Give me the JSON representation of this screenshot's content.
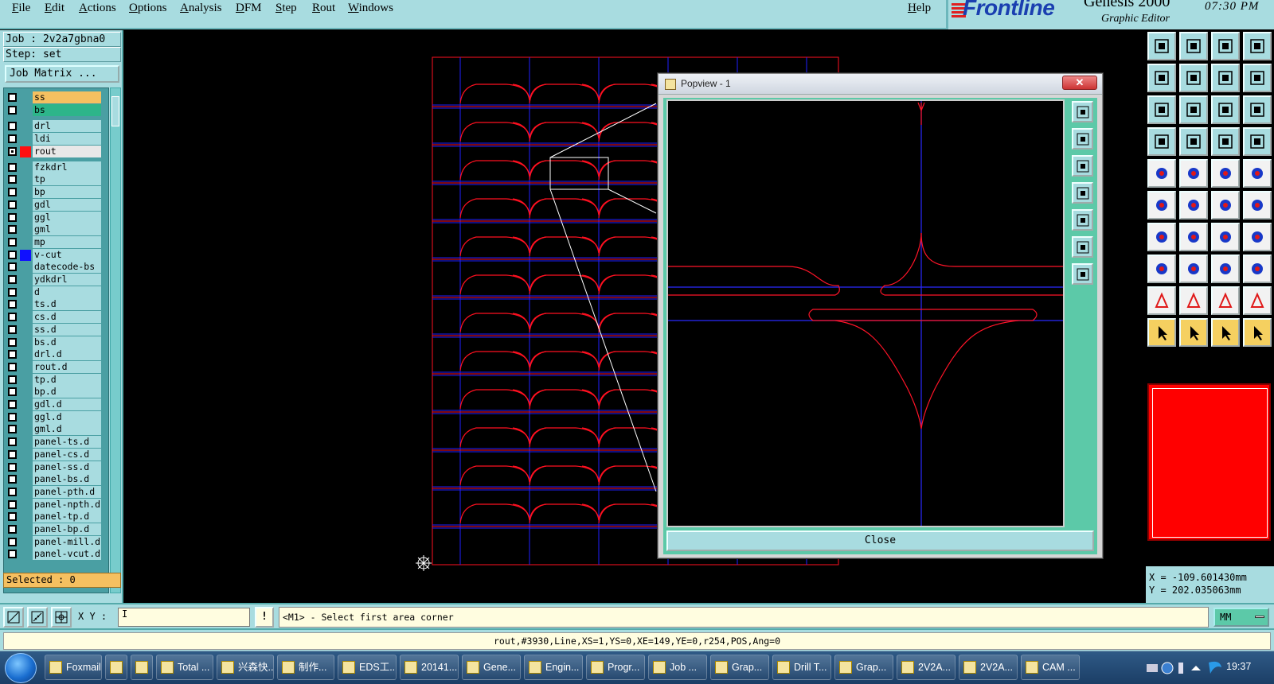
{
  "menu": [
    "File",
    "Edit",
    "Actions",
    "Options",
    "Analysis",
    "DFM",
    "Step",
    "Rout",
    "Windows"
  ],
  "help_label": "Help",
  "brand": {
    "logo": "Frontline",
    "product": "Genesis 2000",
    "subtitle": "Graphic Editor",
    "time": "07:30 PM"
  },
  "job_info": {
    "job": "Job : 2v2a7gbna0",
    "step": "Step: set"
  },
  "job_matrix_label": "Job Matrix ...",
  "layers": [
    {
      "name": "ss",
      "color": "#f5c060"
    },
    {
      "name": "bs",
      "color": "#2db58a"
    },
    {
      "name": "drl",
      "color": "#a8dce0"
    },
    {
      "name": "ldi",
      "color": "#a8dce0"
    },
    {
      "name": "rout",
      "color": "#e8e8e8",
      "swatch": "#ff1010",
      "active": true
    },
    {
      "name": "fzkdrl",
      "color": "#a8dce0"
    },
    {
      "name": "tp",
      "color": "#a8dce0"
    },
    {
      "name": "bp",
      "color": "#a8dce0"
    },
    {
      "name": "gdl",
      "color": "#a8dce0"
    },
    {
      "name": "ggl",
      "color": "#a8dce0"
    },
    {
      "name": "gml",
      "color": "#a8dce0"
    },
    {
      "name": "mp",
      "color": "#a8dce0"
    },
    {
      "name": "v-cut",
      "color": "#a8dce0",
      "swatch": "#1010ff"
    },
    {
      "name": "datecode-bs",
      "color": "#a8dce0"
    },
    {
      "name": "ydkdrl",
      "color": "#a8dce0"
    },
    {
      "name": "d",
      "color": "#a8dce0"
    },
    {
      "name": "ts.d",
      "color": "#a8dce0"
    },
    {
      "name": "cs.d",
      "color": "#a8dce0"
    },
    {
      "name": "ss.d",
      "color": "#a8dce0"
    },
    {
      "name": "bs.d",
      "color": "#a8dce0"
    },
    {
      "name": "drl.d",
      "color": "#a8dce0"
    },
    {
      "name": "rout.d",
      "color": "#a8dce0"
    },
    {
      "name": "tp.d",
      "color": "#a8dce0"
    },
    {
      "name": "bp.d",
      "color": "#a8dce0"
    },
    {
      "name": "gdl.d",
      "color": "#a8dce0"
    },
    {
      "name": "ggl.d",
      "color": "#a8dce0"
    },
    {
      "name": "gml.d",
      "color": "#a8dce0"
    },
    {
      "name": "panel-ts.d",
      "color": "#a8dce0"
    },
    {
      "name": "panel-cs.d",
      "color": "#a8dce0"
    },
    {
      "name": "panel-ss.d",
      "color": "#a8dce0"
    },
    {
      "name": "panel-bs.d",
      "color": "#a8dce0"
    },
    {
      "name": "panel-pth.d",
      "color": "#a8dce0"
    },
    {
      "name": "panel-npth.d",
      "color": "#a8dce0"
    },
    {
      "name": "panel-tp.d",
      "color": "#a8dce0"
    },
    {
      "name": "panel-bp.d",
      "color": "#a8dce0"
    },
    {
      "name": "panel-mill.d",
      "color": "#a8dce0"
    },
    {
      "name": "panel-vcut.d",
      "color": "#a8dce0"
    }
  ],
  "selected_label": "Selected : 0",
  "popview": {
    "title": "Popview - 1",
    "close_x": "✕",
    "close_label": "Close"
  },
  "coords": {
    "x": "X = -109.601430mm",
    "y": "Y = 202.035063mm"
  },
  "cmd": {
    "xy_label": "X Y :",
    "xy_value": "I",
    "excl": "!",
    "prompt": "<M1> - Select first area corner",
    "unit": "MM"
  },
  "status_line": "rout,#3930,Line,XS=1,YS=0,XE=149,YE=0,r254,POS,Ang=0",
  "taskbar": [
    {
      "label": "Foxmail",
      "w": 72
    },
    {
      "label": "",
      "w": 28
    },
    {
      "label": "",
      "w": 28
    },
    {
      "label": "Total ...",
      "w": 72
    },
    {
      "label": "兴森快...",
      "w": 72
    },
    {
      "label": "制作...",
      "w": 72
    },
    {
      "label": "EDS工...",
      "w": 74
    },
    {
      "label": "20141...",
      "w": 74
    },
    {
      "label": "Gene...",
      "w": 74
    },
    {
      "label": "Engin...",
      "w": 74
    },
    {
      "label": "Progr...",
      "w": 74
    },
    {
      "label": "Job ...",
      "w": 74
    },
    {
      "label": "Grap...",
      "w": 74
    },
    {
      "label": "Drill T...",
      "w": 74
    },
    {
      "label": "Grap...",
      "w": 74
    },
    {
      "label": "2V2A...",
      "w": 74
    },
    {
      "label": "2V2A...",
      "w": 74
    },
    {
      "label": "CAM ...",
      "w": 74
    }
  ],
  "clock": "19:37",
  "colors": {
    "panel": "#a8dce0",
    "rout": "#ff1020",
    "vcut": "#2020ff"
  }
}
